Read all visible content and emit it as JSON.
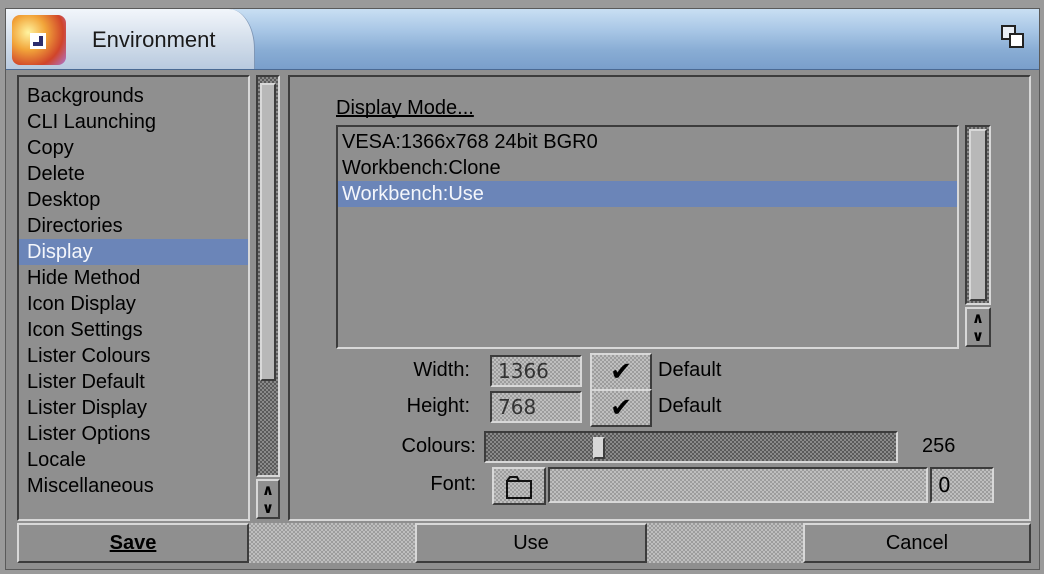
{
  "window": {
    "title": "Environment"
  },
  "categories": {
    "items": [
      "Backgrounds",
      "CLI Launching",
      "Copy",
      "Delete",
      "Desktop",
      "Directories",
      "Display",
      "Hide Method",
      "Icon Display",
      "Icon Settings",
      "Lister Colours",
      "Lister Default",
      "Lister Display",
      "Lister Options",
      "Locale",
      "Miscellaneous"
    ],
    "selected": "Display"
  },
  "display": {
    "mode_label": "Display Mode...",
    "modes": [
      "VESA:1366x768 24bit BGR0",
      "Workbench:Clone",
      "Workbench:Use"
    ],
    "selected_mode": "Workbench:Use",
    "width_label": "Width:",
    "width_value": "1366",
    "width_default": "Default",
    "height_label": "Height:",
    "height_value": "768",
    "height_default": "Default",
    "colours_label": "Colours:",
    "colours_value": "256",
    "colours_slider_fraction": 0.27,
    "font_label": "Font:",
    "font_name": "",
    "font_size": "0"
  },
  "buttons": {
    "save": "Save",
    "use": "Use",
    "cancel": "Cancel"
  },
  "icons": {
    "check": "✔",
    "arrows": "▲▼",
    "folder": "folder-icon",
    "depth": "window-depth-icon"
  }
}
